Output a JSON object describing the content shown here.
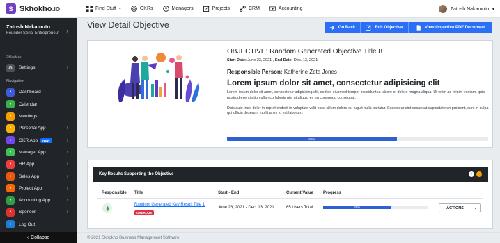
{
  "brand": {
    "logo_letter": "S",
    "name": "Skhokho",
    "suffix": ".io"
  },
  "topnav": [
    {
      "label": "Find Stuff",
      "icon": "grid-icon",
      "dropdown": true
    },
    {
      "label": "OKRs",
      "icon": "target-icon"
    },
    {
      "label": "Managers",
      "icon": "user-circle-icon"
    },
    {
      "label": "Projects",
      "icon": "pencil-square-icon"
    },
    {
      "label": "CRM",
      "icon": "link-icon"
    },
    {
      "label": "Accounting",
      "icon": "cash-icon"
    }
  ],
  "user": {
    "name": "Zatosh Nakamoto",
    "title": "Founder Serial Entrepreneur"
  },
  "sidebar": {
    "section_skhokho": "Skhokho",
    "settings_label": "Settings",
    "section_navigation": "Navigation",
    "items": [
      {
        "label": "Dashboard",
        "color": "#3b5bdb",
        "icon": "dashboard-icon",
        "chevron": false
      },
      {
        "label": "Calendar",
        "color": "#37b24d",
        "icon": "calendar-icon",
        "chevron": false
      },
      {
        "label": "Meetings",
        "color": "#f59f00",
        "icon": "meetings-icon",
        "chevron": false
      },
      {
        "label": "Personal App",
        "color": "#fab005",
        "icon": "personal-app-icon",
        "chevron": true
      },
      {
        "label": "OKR App",
        "color": "#7048e8",
        "icon": "okr-icon",
        "chevron": true,
        "badge": "NEW"
      },
      {
        "label": "Manager App",
        "color": "#40c057",
        "icon": "manager-icon",
        "chevron": true
      },
      {
        "label": "HR App",
        "color": "#f03e3e",
        "icon": "hr-icon",
        "chevron": true
      },
      {
        "label": "Sales App",
        "color": "#e8590c",
        "icon": "sales-icon",
        "chevron": true
      },
      {
        "label": "Project App",
        "color": "#f76707",
        "icon": "project-icon",
        "chevron": true
      },
      {
        "label": "Accounting App",
        "color": "#2f9e44",
        "icon": "accounting-icon",
        "chevron": true
      },
      {
        "label": "Sponsor",
        "color": "#e03131",
        "icon": "sponsor-icon",
        "chevron": true
      },
      {
        "label": "Log Out",
        "color": "#1c7ed6",
        "icon": "logout-icon",
        "chevron": false
      }
    ],
    "collapse_label": "Collapse"
  },
  "page": {
    "title": "View Detail Objective",
    "buttons": {
      "go_back": "Go Back",
      "edit": "Edit Objective",
      "pdf": "View Objective PDF Document"
    }
  },
  "objective": {
    "title": "OBJECTIVE: Random Generated Objective Title 8",
    "start_label": "Start Date:",
    "start_date": "June 23, 2021",
    "end_label": "End Date:",
    "end_date": "Dec. 13, 2021",
    "person_label": "Responsible Person:",
    "person": "Katherine Zeta Jones",
    "heading": "Lorem ipsum dolor sit amet, consectetur adipisicing elit",
    "para1": "Lorem ipsum dolor sit amet, consectetur adipisicing elit, sed do eiusmod tempor incididunt ut labore et dolore magna aliqua. Ut enim ad minim veniam, quis nostrud exercitation ullamco laboris nisi ut aliquip ex ea commodo consequat.",
    "para2": "Duis aute irure dolor in reprehenderit in voluptate velit esse cillum dolore eu fugiat nulla pariatur. Excepteur sint occaecat cupidatat non proident, sunt in culpa qui officia deserunt mollit anim id est laborum.",
    "progress": 65,
    "progress_label": "65%"
  },
  "key_results": {
    "title": "Key Results Supporting the Objective",
    "columns": {
      "responsible": "Responsible",
      "title": "Title",
      "start_end": "Start - End",
      "current_value": "Current Value",
      "progress": "Progress"
    },
    "row": {
      "title": "Random Generated Key Result Title 1",
      "status": "OVERDUE",
      "start_end": "June 23, 2021 - Dec. 13, 2021",
      "current_value": "65 Users Total",
      "progress": 65,
      "progress_label": "65%",
      "actions_label": "ACTIONS"
    }
  },
  "footer": {
    "text": "© 2021 Skhokho Business Management Software"
  }
}
